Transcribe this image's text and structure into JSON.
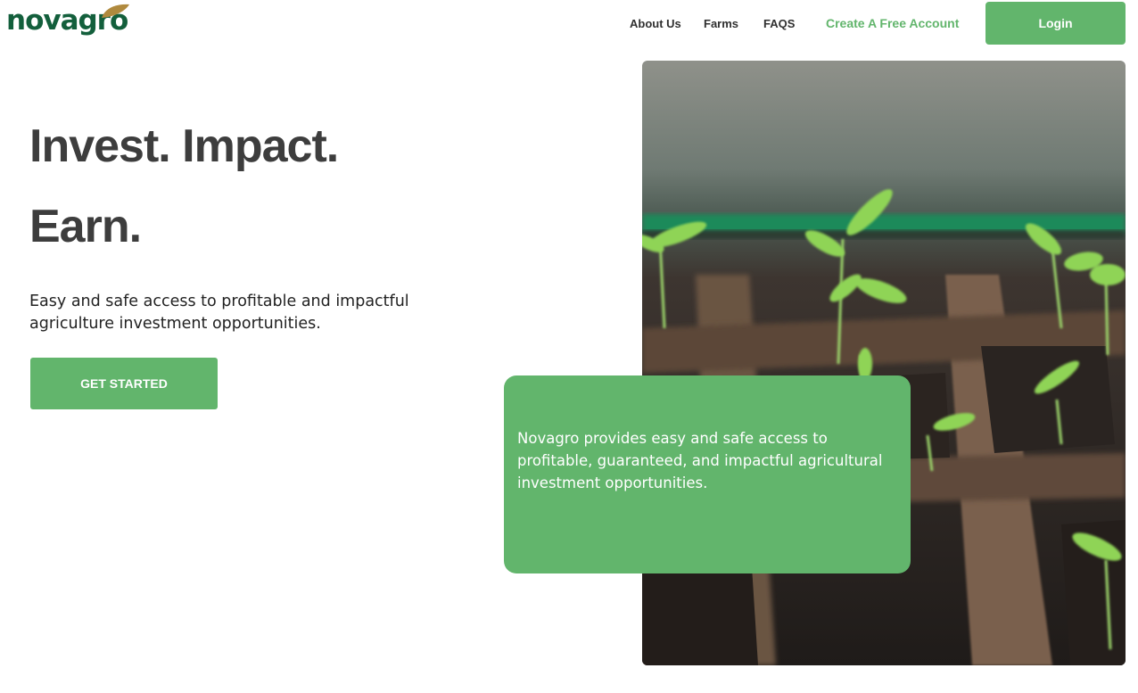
{
  "brand": {
    "name": "novagro",
    "primary_color": "#62b56c",
    "logo_color": "#135f3c",
    "leaf_color": "#b08a3e"
  },
  "nav": {
    "about": "About Us",
    "farms": "Farms",
    "faqs": "FAQS",
    "create_account": "Create A Free Account",
    "login": "Login"
  },
  "hero": {
    "line1": "Invest. Impact.",
    "line2": "Earn.",
    "subtitle": "Easy and safe access to profitable and impactful agriculture investment opportunities.",
    "cta": "GET STARTED"
  },
  "info_card": {
    "text": "Novagro provides easy and safe access to profitable, guaranteed, and impactful agricultural investment opportunities."
  },
  "image": {
    "subject": "seedlings-in-soil-trays"
  }
}
